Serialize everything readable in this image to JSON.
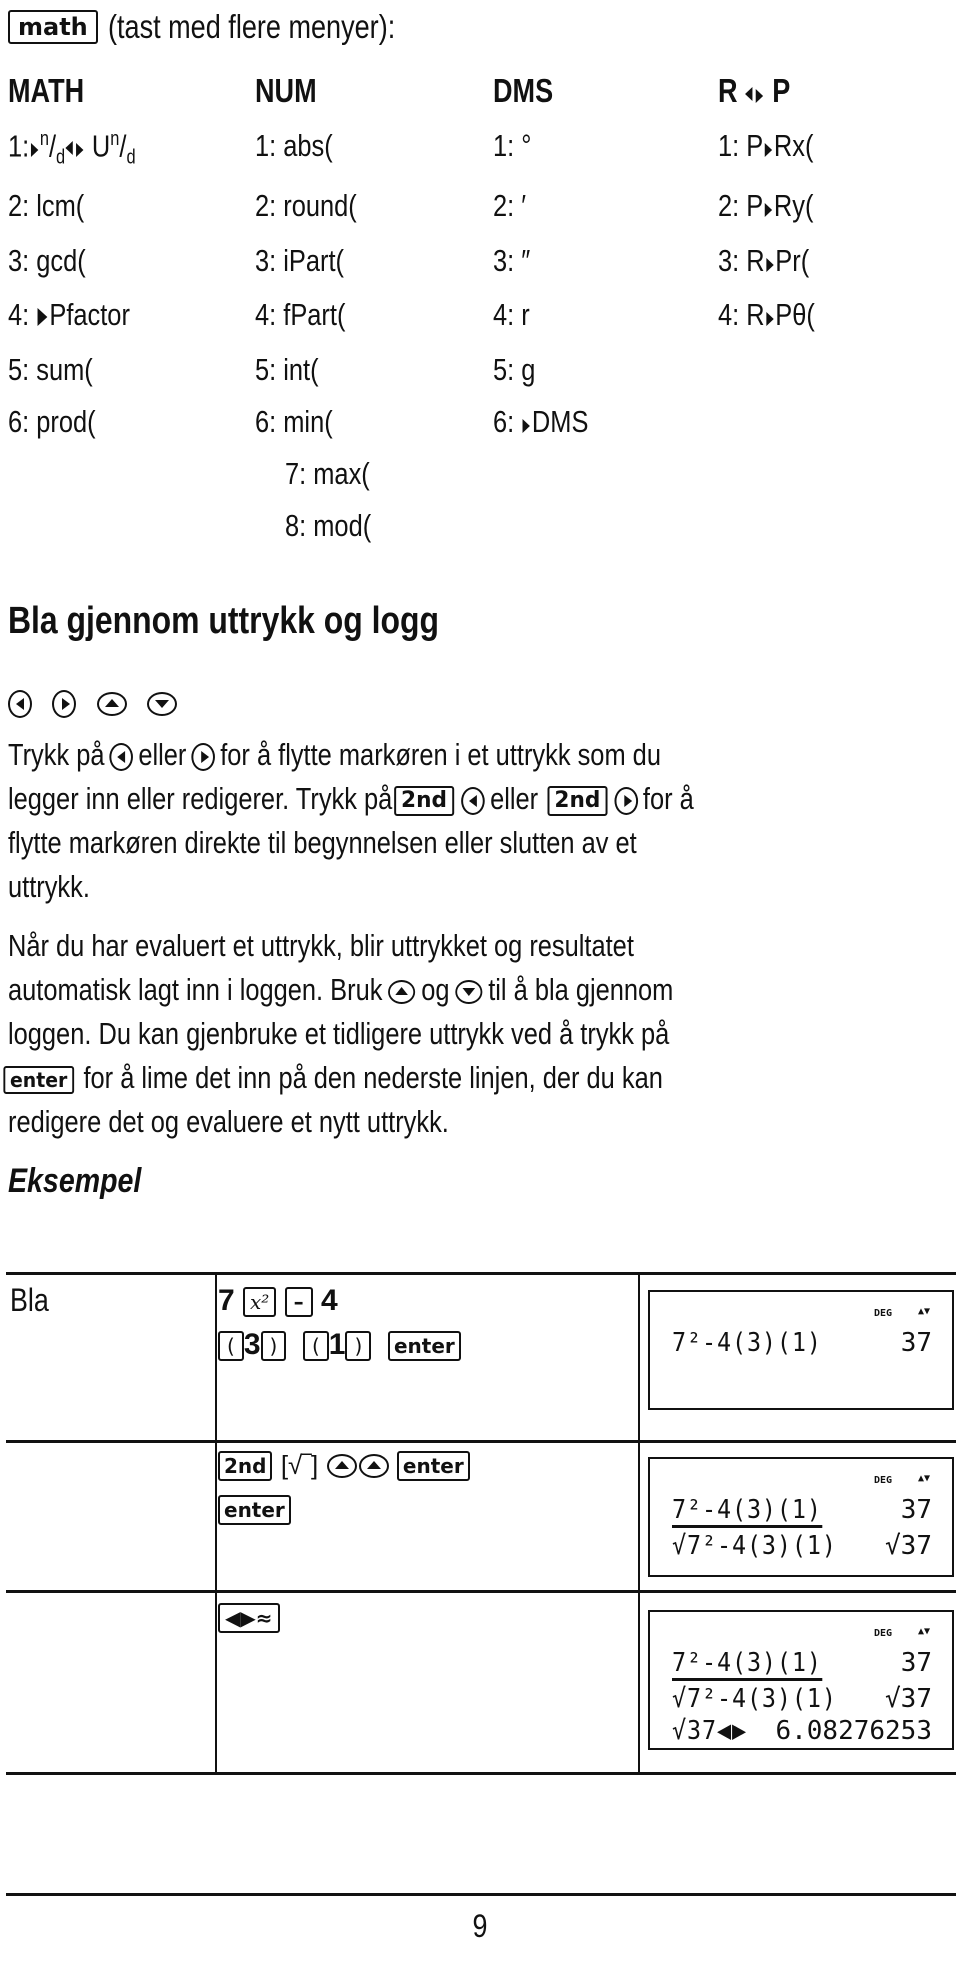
{
  "intro": {
    "key_label": "math",
    "text": "(tast med flere menyer):"
  },
  "menus": [
    {
      "title": "MATH",
      "items": [
        "1:▶n/d◀▶ Un/d",
        "2: lcm(",
        "3: gcd(",
        "4: ▶Pfactor",
        "5: sum(",
        "6: prod("
      ]
    },
    {
      "title": "NUM",
      "items": [
        "1: abs(",
        "2: round(",
        "3: iPart(",
        "4: fPart(",
        "5: int(",
        "6: min(",
        "7: max(",
        "8: mod("
      ]
    },
    {
      "title": "DMS",
      "items": [
        "1: °",
        "2: ′",
        "3: ″",
        "4: r",
        "5: g",
        "6: ▶DMS"
      ]
    },
    {
      "title": "R ◀▶ P",
      "items": [
        "1: P▶Rx(",
        "2: P▶Ry(",
        "3: R▶Pr(",
        "4: R▶Pθ("
      ]
    }
  ],
  "math_item1": {
    "prefix": "1:",
    "n": "n",
    "d": "d",
    "u": "U"
  },
  "math_item4": {
    "prefix": "4: ",
    "rest": "Pfactor"
  },
  "dms_item6": {
    "prefix": "6: ",
    "rest": "DMS"
  },
  "rp_items": [
    {
      "prefix": "1: P",
      "rest": "Rx("
    },
    {
      "prefix": "2: P",
      "rest": "Ry("
    },
    {
      "prefix": "3: R",
      "rest": "Pr("
    },
    {
      "prefix": "4: R",
      "rest": "Pθ("
    }
  ],
  "rp_title": {
    "left": "R",
    "right": "P"
  },
  "section": {
    "title": "Bla gjennom uttrykk og logg",
    "arrow_keys": [
      "left-arrow",
      "right-arrow",
      "up-arrow",
      "down-arrow"
    ],
    "p1": {
      "l1_a": "Trykk på",
      "l1_b": "eller",
      "l1_c": "for å flytte markøren i et uttrykk som du",
      "l2_a": "legger inn eller redigerer. Trykk på",
      "key_2nd": "2nd",
      "l2_b": "eller",
      "l2_c": "for å",
      "l3": "flytte markøren direkte til begynnelsen eller slutten av et",
      "l4": "uttrykk."
    },
    "p2": {
      "l1": "Når du har evaluert et uttrykk, blir uttrykket og resultatet",
      "l2_a": "automatisk lagt inn i loggen. Bruk",
      "l2_b": "og",
      "l2_c": "til å bla gjennom",
      "l3": "loggen. Du kan gjenbruke et tidligere uttrykk ved å trykk på",
      "key_enter": "enter",
      "l4": "for å lime det inn på den nederste linjen, der du kan",
      "l5": "redigere det og evaluere et nytt uttrykk."
    }
  },
  "example": {
    "heading": "Eksempel",
    "rows": [
      {
        "label": "Bla",
        "keys": {
          "seven": "7",
          "x2": "x²",
          "minus": "–",
          "four": "4",
          "lparen": "(",
          "three": "3",
          "rparen": ")",
          "one": "1",
          "enter": "enter"
        },
        "screen": {
          "mode": "DEG",
          "scroll": "▲▼",
          "lines": [
            {
              "expr": "7²-4(3)(1)",
              "result": "37"
            }
          ]
        }
      },
      {
        "label": "",
        "keys": {
          "second": "2nd",
          "sqrt": "[√‾]",
          "enter1": "enter",
          "enter2": "enter"
        },
        "screen": {
          "mode": "DEG",
          "scroll": "▲▼",
          "lines": [
            {
              "expr": "7²-4(3)(1)",
              "result": "37"
            },
            {
              "expr": "√7²-4(3)(1)",
              "result": "√37"
            }
          ]
        }
      },
      {
        "label": "",
        "keys": {
          "approx": "◀▶≈"
        },
        "screen": {
          "mode": "DEG",
          "scroll": "▲▼",
          "lines": [
            {
              "expr": "7²-4(3)(1)",
              "result": "37"
            },
            {
              "expr": "√7²-4(3)(1)",
              "result": "√37"
            },
            {
              "expr": "√37◀▶",
              "result": "6.08276253"
            }
          ]
        }
      }
    ]
  },
  "page_number": "9"
}
